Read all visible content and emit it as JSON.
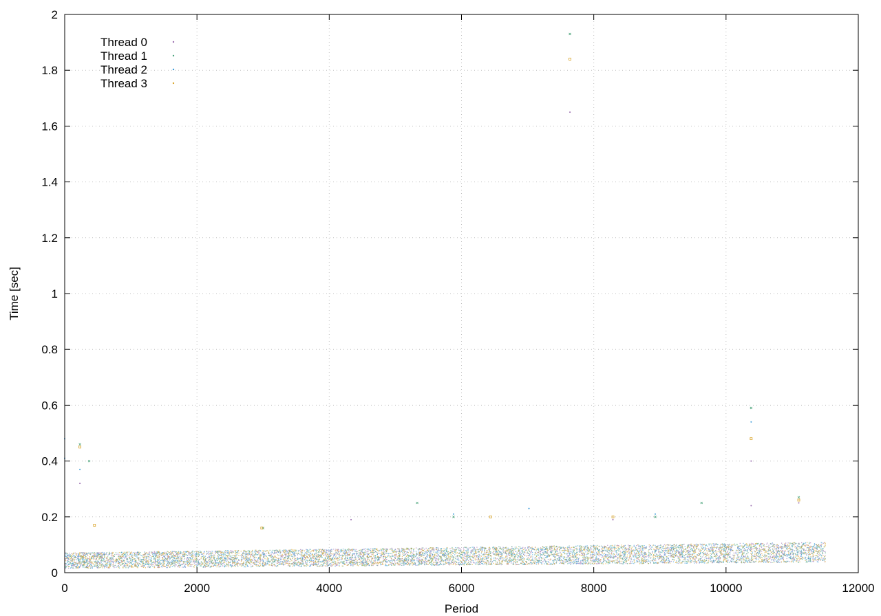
{
  "chart_data": {
    "type": "scatter",
    "xlabel": "Period",
    "ylabel": "Time [sec]",
    "xlim": [
      0,
      12000
    ],
    "ylim": [
      0,
      2
    ],
    "x_ticks": [
      "0",
      "2000",
      "4000",
      "6000",
      "8000",
      "10000",
      "12000"
    ],
    "y_ticks": [
      "0",
      "0.2",
      "0.4",
      "0.6",
      "0.8",
      "1",
      "1.2",
      "1.4",
      "1.6",
      "1.8",
      "2"
    ],
    "grid": true,
    "legend_position": "top-left",
    "series": [
      {
        "name": "Thread 0",
        "color": "#9b6fb0",
        "marker": "dot",
        "points": [
          [
            7640,
            1.65
          ],
          [
            10380,
            0.4
          ],
          [
            10380,
            0.24
          ],
          [
            230,
            0.32
          ],
          [
            11100,
            0.25
          ],
          [
            8290,
            0.19
          ],
          [
            4330,
            0.19
          ]
        ]
      },
      {
        "name": "Thread 1",
        "color": "#4aa37a",
        "marker": "cross",
        "points": [
          [
            7640,
            1.93
          ],
          [
            10380,
            0.59
          ],
          [
            230,
            0.46
          ],
          [
            370,
            0.4
          ],
          [
            5330,
            0.25
          ],
          [
            5880,
            0.2
          ],
          [
            9630,
            0.25
          ],
          [
            11100,
            0.27
          ],
          [
            8930,
            0.2
          ],
          [
            3000,
            0.16
          ]
        ]
      },
      {
        "name": "Thread 2",
        "color": "#3b9ad9",
        "marker": "dot",
        "points": [
          [
            10380,
            0.54
          ],
          [
            230,
            0.37
          ],
          [
            7020,
            0.23
          ],
          [
            8930,
            0.21
          ],
          [
            5880,
            0.21
          ],
          [
            0,
            0.48
          ],
          [
            0,
            0.41
          ]
        ]
      },
      {
        "name": "Thread 3",
        "color": "#d9a42a",
        "marker": "square",
        "points": [
          [
            7640,
            1.84
          ],
          [
            10380,
            0.48
          ],
          [
            230,
            0.45
          ],
          [
            8290,
            0.2
          ],
          [
            6440,
            0.2
          ],
          [
            450,
            0.17
          ],
          [
            2980,
            0.16
          ],
          [
            11100,
            0.26
          ]
        ]
      }
    ]
  }
}
